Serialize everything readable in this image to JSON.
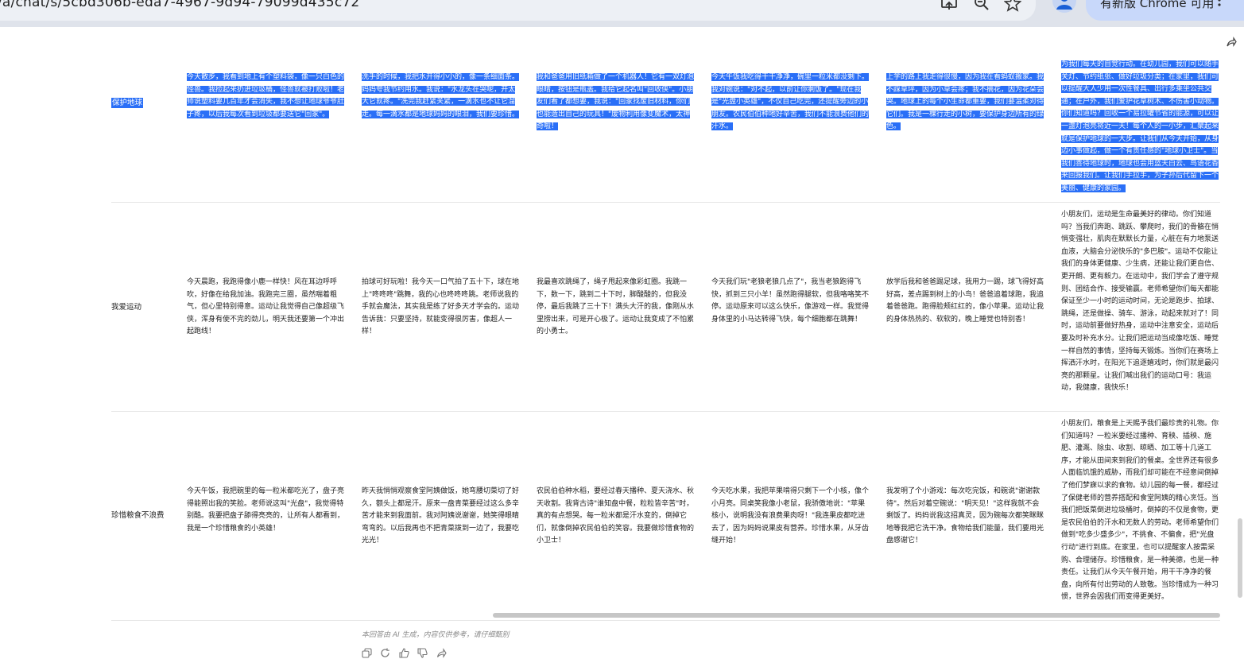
{
  "browser": {
    "url": "/a/chat/s/5cbd306b-eda7-4967-9d94-79099d435c72",
    "update_label": "有新版 Chrome 可用"
  },
  "table": {
    "rows": [
      {
        "label": "保护地球",
        "cells": [
          "今天散步，我看到地上有个塑料袋，像一只白色的怪兽。我捡起来扔进垃圾桶，怪兽就被打败啦！老师说塑料要几百年才会消失，我不想让地球爷爷肚子疼，以后我每次看到垃圾都要送它\"回家\"。",
          "洗手的时候，我把水开得小小的，像一条细面条。妈妈夸我节约用水。我说：\"水龙头在哭呢，开太大它就疼。\"洗完我赶紧关紧，一滴水也不让它溜走。每一滴水都是地球妈妈的眼泪，我们要珍惜。",
          "我和爸爸用旧纸箱做了一个机器人！它有一双灯泡眼睛，按钮是瓶盖。我给它起名叫\"回收侠\"。小朋友们看了都想要，我说：\"回家找废旧材料，你们也能造出自己的玩具！\"废物利用像变魔术，太神奇啦！",
          "今天午饭我吃得干干净净，碗里一粒米都没剩下。我对碗说：\"对不起，以前让你剩饭了。\"现在我是\"光盘小英雄\"，不仅自己吃完，还提醒旁边的小朋友。农民伯伯种地好辛苦，我们不能浪费他们的汗水。",
          "上学的路上我走得很慢，因为我在看蚂蚁搬家。我不踩草坪，因为小草会疼；我不摘花，因为花朵会哭。地球上的每个小生命都重要，我们要温柔对待它们。我是一棵行走的小树，要保护身边所有的绿色。",
          "为我们每天的自觉行动。在幼儿园，我们可以随手关灯、节约纸张、做好垃圾分类；在家里，我们可以提醒大人少用一次性餐具、出行多乘坐公共交通；在户外，我们爱护花草树木、不伤害小动物。你们知道吗？回收一个易拉罐节省的能源，可以让一盏灯泡亮将近一天！每个人的一小步，汇聚起来就是保护地球的一大步。让我们从今天开始，从身边小事做起，做一个有责任感的\"地球小卫士\"。当我们善待地球时，地球也会用蓝天白云、鸟语花香来回报我们。让我们手拉手，为子孙后代留下一个美丽、健康的家园。"
        ]
      },
      {
        "label": "我爱运动",
        "cells": [
          "今天晨跑，我跑得像小鹿一样快！风在耳边呼呼吹，好像在给我加油。我跑完三圈，虽然喘着粗气，但心里特别得意。运动让我觉得自己像超级飞侠，浑身有使不完的劲儿，明天我还要第一个冲出起跑线！",
          "拍球可好玩啦！我今天一口气拍了五十下，球在地上\"咚咚咚\"跳舞，我的心也咚咚咚跳。老师说我的手就会魔法，其实我是练了好多天才学会的。运动告诉我：只要坚持，就能变得很厉害，像超人一样！",
          "我最喜欢跳绳了，绳子甩起来像彩虹圈。我跳一下，数一下，跳到二十下时，脚酸酸的，但我没停，最后我跳了三十下！满头大汗的我，像刚从水里捞出来，可是开心极了。运动让我变成了不怕累的小勇士。",
          "今天我们玩\"老狼老狼几点了\"，我当老狼跑得飞快，抓到三只小羊！虽然跑得腿软，但我咯咯笑不停。运动原来可以这么快乐，像游戏一样。我觉得身体里的小马达转得飞快，每个细胞都在跳舞！",
          "放学后我和爸爸踢足球，我用力一踢，球飞得好高好高，差点踢到树上的小鸟！爸爸追着球跑，我追着爸爸跑。跑得脸颊红红的，像小苹果。运动让我的身体热热的、软软的，晚上睡觉也特别香！",
          "小朋友们，运动是生命最美好的律动。你们知道吗？当我们奔跑、跳跃、攀爬时，我们的骨骼在悄悄变强壮，肌肉在默默长力量，心脏在有力地泵送血液，大脑会分泌快乐的\"多巴胺\"。运动不仅能让我们的身体更健康、少生病，还能让我们更自信、更开朗、更有毅力。在运动中，我们学会了遵守规则、团结合作、接受输赢。老师希望你们每天都能保证至少一小时的运动时间，无论是跑步、拍球、跳绳，还是做操、骑车、游泳，动起来就对了！同时，运动前要做好热身，运动中注意安全，运动后要及时补充水分。让我们把运动当成像吃饭、睡觉一样自然的事情，坚持每天锻炼。当你们在赛场上挥洒汗水时，在阳光下追逐嬉戏时，你们就是最闪亮的那颗星。让我们喊出我们的运动口号：我运动，我健康，我快乐！"
        ]
      },
      {
        "label": "珍惜粮食不浪费",
        "cells": [
          "今天午饭，我把碗里的每一粒米都吃光了，盘子亮得能照出我的笑脸。老师说这叫\"光盘\"，我觉得特别酷。我要把盘子舔得亮亮的，让所有人都看到，我是一个珍惜粮食的小英雄！",
          "昨天我悄悄观察食堂阿姨做饭，她弯腰切菜切了好久，额头上都是汗。原来一盘青菜要经过这么多辛苦才能来到我面前。我对阿姨说谢谢，她笑得眼睛弯弯的。以后我再也不把青菜拨到一边了，我要吃光光！",
          "农民伯伯种水稻，要经过春天播种、夏天浇水、秋天收割。我背古诗\"谁知盘中餐，粒粒皆辛苦\"时，真的有点想哭。每一粒米都是汗水变的，倒掉它们，就像倒掉农民伯伯的笑容。我要做珍惜食物的小卫士！",
          "今天吃水果，我把苹果啃得只剩下一个小核，像个小月亮。同桌笑我像小老鼠，我骄傲地说：\"苹果核小，说明我没有浪费果肉呀！\"我连果皮都吃进去了，因为妈妈说果皮有营养。珍惜水果，从牙齿缝开始！",
          "我发明了个小游戏：每次吃完饭，和碗说\"谢谢款待\"。然后对着空碗说：\"明天见！\"这样我就不会剩饭了。妈妈说我这招真灵，因为碗每次都笑眯眯地等我把它洗干净。食物给我们能量，我们要用光盘感谢它！",
          "小朋友们，粮食是上天赐予我们最珍贵的礼物。你们知道吗？一粒米要经过播种、育秧、插秧、施肥、灌溉、除虫、收割、晾晒、加工等十几道工序，才能从田间来到我们的餐桌。全世界还有很多人面临饥饿的威胁，而我们却可能在不经意间倒掉了他们梦寐以求的食物。幼儿园的每一餐，都经过了保健老师的营养搭配和食堂阿姨的精心烹饪。当我们把饭菜倒进垃圾桶时，倒掉的不仅是食物，更是农民伯伯的汗水和无数人的劳动。老师希望你们做到\"吃多少盛多少\"，不挑食、不偏食，把\"光盘行动\"进行到底。在家里，也可以提醒家人按需采购、合理储存。珍惜粮食，是一种美德，也是一种责任。让我们从今天午餐开始，用干干净净的餐盘，向所有付出劳动的人致敬。当珍惜成为一种习惯，世界会因我们而变得更美好。"
        ]
      }
    ]
  },
  "footer": {
    "disclaimer": "本回答由 AI 生成，内容仅供参考，请仔细甄别"
  },
  "icons": [
    "screen-cast-icon",
    "zoom-icon",
    "star-icon",
    "profile-icon",
    "more-vert-icon",
    "share-icon",
    "copy-icon",
    "regenerate-icon",
    "thumbs-up-icon",
    "thumbs-down-icon",
    "share-answer-icon"
  ],
  "colors": {
    "selection": "#2a6ff7",
    "update_chip": "#c8d8fa"
  }
}
